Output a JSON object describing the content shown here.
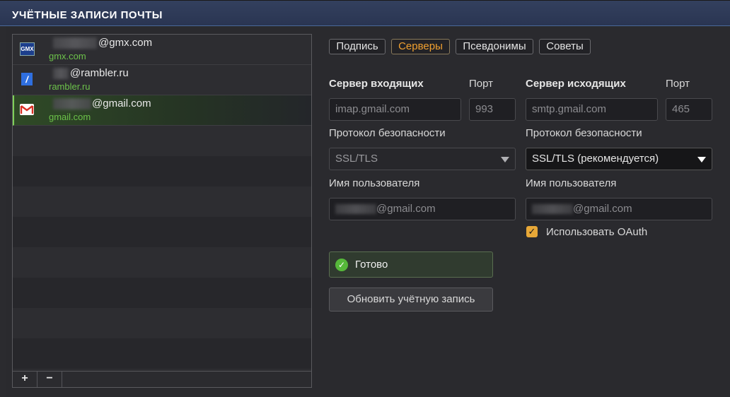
{
  "window": {
    "title": "УЧЁТНЫЕ ЗАПИСИ ПОЧТЫ"
  },
  "accounts": [
    {
      "email": "@gmx.com",
      "domain": "gmx.com",
      "icon": "gmx-icon",
      "icon_text": "GMX",
      "selected": false
    },
    {
      "email": "@rambler.ru",
      "domain": "rambler.ru",
      "icon": "rambler-icon",
      "icon_text": "/",
      "selected": false
    },
    {
      "email": "@gmail.com",
      "domain": "gmail.com",
      "icon": "gmail-icon",
      "icon_text": "M",
      "selected": true
    }
  ],
  "list_footer": {
    "add_label": "+",
    "remove_label": "−"
  },
  "tabs": [
    {
      "label": "Подпись",
      "active": false
    },
    {
      "label": "Серверы",
      "active": true
    },
    {
      "label": "Псевдонимы",
      "active": false
    },
    {
      "label": "Советы",
      "active": false
    }
  ],
  "incoming": {
    "heading": "Сервер входящих",
    "port_label": "Порт",
    "server": "imap.gmail.com",
    "port": "993",
    "security_label": "Протокол безопасности",
    "security_value": "SSL/TLS",
    "username_label": "Имя пользователя",
    "username": "@gmail.com"
  },
  "outgoing": {
    "heading": "Сервер исходящих",
    "port_label": "Порт",
    "server": "smtp.gmail.com",
    "port": "465",
    "security_label": "Протокол безопасности",
    "security_value": "SSL/TLS (рекомендуется)",
    "username_label": "Имя пользователя",
    "username": "@gmail.com",
    "oauth_label": "Использовать OAuth",
    "oauth_checked": true
  },
  "status": {
    "text": "Готово"
  },
  "update_button": {
    "label": "Обновить учётную запись"
  },
  "colors": {
    "accent": "#f0a030",
    "domain_text": "#6cc24a",
    "checkbox": "#e8a838",
    "status_ok": "#56b83a"
  }
}
